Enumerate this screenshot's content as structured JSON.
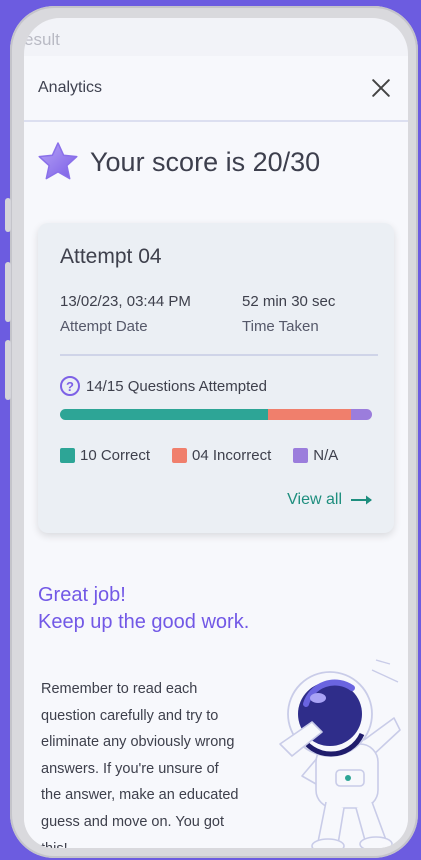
{
  "background_label": "esult",
  "header": {
    "title": "Analytics",
    "close_icon": "close-icon"
  },
  "score": {
    "text": "Your score is 20/30",
    "icon": "star-icon"
  },
  "attempt": {
    "title": "Attempt 04",
    "date_value": "13/02/23, 03:44 PM",
    "date_label": "Attempt Date",
    "time_value": "52 min 30 sec",
    "time_label": "Time Taken"
  },
  "questions": {
    "icon": "question-circle-icon",
    "icon_glyph": "?",
    "text": "14/15 Questions Attempted",
    "correct": 10,
    "incorrect": 4,
    "na": 1,
    "total": 15
  },
  "legend": {
    "correct_label": "10 Correct",
    "incorrect_label": "04 Incorrect",
    "na_label": "N/A"
  },
  "colors": {
    "correct": "#2da596",
    "incorrect": "#f07f6c",
    "na": "#9b7ddc",
    "accent": "#7258e6",
    "link": "#1e8e7e"
  },
  "view_all": {
    "label": "View all",
    "icon": "arrow-right-icon"
  },
  "message": {
    "line1": "Great job!",
    "line2": "Keep up the good work.",
    "tips_lines": [
      "Remember to read each",
      "question carefully and try to",
      "eliminate any obviously wrong",
      "answers. If you're unsure of",
      "the answer, make an educated",
      "guess and move on. You got",
      "this!"
    ]
  },
  "illustration": "astronaut-illustration"
}
